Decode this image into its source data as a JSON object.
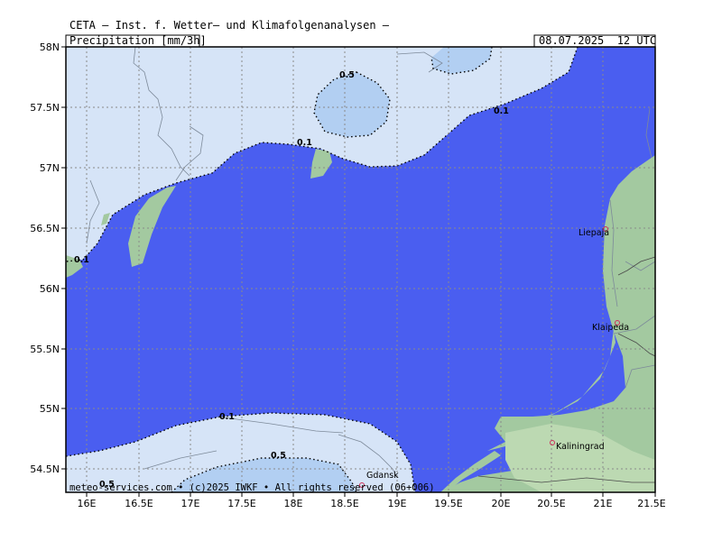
{
  "header": {
    "source": "CETA — Inst. f. Wetter— und Klimafolgenanalysen —",
    "field": "Precipitation [mm/3h]",
    "valid_time": "08.07.2025  12 UTC"
  },
  "footer": {
    "copyright": "meteo-services.com • (c)2025 IWKF • All rights reserved (06+006)"
  },
  "axes": {
    "lat_labels": [
      "58N",
      "57.5N",
      "57N",
      "56.5N",
      "56N",
      "55.5N",
      "55N",
      "54.5N"
    ],
    "lon_labels": [
      "16E",
      "16.5E",
      "17E",
      "17.5E",
      "18E",
      "18.5E",
      "19E",
      "19.5E",
      "20E",
      "20.5E",
      "21E",
      "21.5E"
    ]
  },
  "contours": {
    "levels": [
      "0.1",
      "0.5"
    ],
    "labels": [
      {
        "text": "0.5"
      },
      {
        "text": "0.1"
      },
      {
        "text": "0.1"
      },
      {
        "text": "0.1"
      },
      {
        "text": "0.1"
      },
      {
        "text": "0.5"
      },
      {
        "text": "0.5"
      }
    ]
  },
  "cities": [
    {
      "name": "Liepaja"
    },
    {
      "name": "Klaipeda"
    },
    {
      "name": "Kaliningrad"
    },
    {
      "name": "Gdansk"
    }
  ],
  "colors": {
    "sea": "#4a5ef0",
    "precip_low": "#d6e4f7",
    "precip_mid": "#b2cff2",
    "land": "#a3c9a0",
    "land_light": "#bcd9b2"
  }
}
